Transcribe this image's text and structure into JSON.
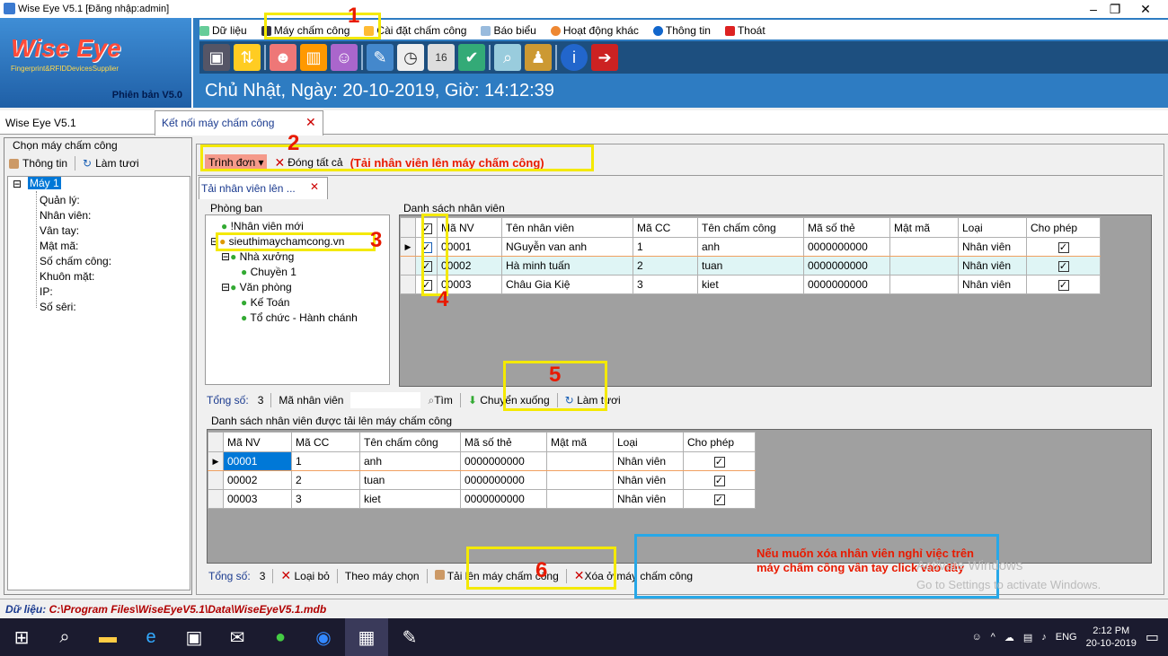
{
  "window": {
    "title": "Wise Eye V5.1 [Đăng nhập:admin]"
  },
  "logo": {
    "brand": "Wise Eye",
    "tagline": "Fingerprint&RFIDDevicesSupplier",
    "version": "Phiên bản V5.0"
  },
  "menu": [
    "Dữ liệu",
    "Máy chấm công",
    "Cài đặt chấm công",
    "Báo biểu",
    "Hoạt động khác",
    "Thông tin",
    "Thoát"
  ],
  "datetime": "Chủ Nhật, Ngày: 20-10-2019, Giờ: 14:12:39",
  "tabs": {
    "home": "Wise Eye V5.1",
    "connect": "Kết nối máy chấm công"
  },
  "left": {
    "group_title": "Chọn máy chấm công",
    "info_btn": "Thông tin",
    "refresh_btn": "Làm tươi",
    "machine": "Máy 1",
    "props": [
      "Quản lý:",
      "Nhân viên:",
      "Vân tay:",
      "Mật mã:",
      "Số chấm công:",
      "Khuôn mặt:",
      "IP:",
      "Số sêri:"
    ]
  },
  "main": {
    "menu_btn": "Trình đơn",
    "close_all": "Đóng tất cả",
    "callout_title": "(Tải nhân viên lên máy chấm công)",
    "subtab": "Tải nhân viên lên ...",
    "dept_title": "Phòng ban",
    "depts": [
      "!Nhân viên mới",
      "sieuthimaychamcong.vn",
      "Nhà xưởng",
      "Chuyền 1",
      "Văn phòng",
      "Kế Toán",
      "Tổ chức - Hành chánh"
    ],
    "emp_list_title": "Danh sách nhân viên",
    "emp_cols": [
      "Mã NV",
      "Tên nhân viên",
      "Mã CC",
      "Tên chấm công",
      "Mã số thẻ",
      "Mật mã",
      "Loại",
      "Cho phép"
    ],
    "emp_rows": [
      [
        "00001",
        "NGuyễn van anh",
        "1",
        "anh",
        "0000000000",
        "",
        "Nhân viên"
      ],
      [
        "00002",
        "Hà minh tuấn",
        "2",
        "tuan",
        "0000000000",
        "",
        "Nhân viên"
      ],
      [
        "00003",
        "Châu Gia Kiệ",
        "3",
        "kiet",
        "0000000000",
        "",
        "Nhân viên"
      ]
    ],
    "total_label": "Tổng số:",
    "total": "3",
    "empid_label": "Mã nhân viên",
    "search": "Tìm",
    "move_down": "Chuyển xuống",
    "refresh": "Làm tươi",
    "upload_list_title": "Danh sách nhân viên được tải lên máy chấm công",
    "up_cols": [
      "Mã NV",
      "Mã CC",
      "Tên chấm công",
      "Mã số thẻ",
      "Mật mã",
      "Loại",
      "Cho phép"
    ],
    "up_rows": [
      [
        "00001",
        "1",
        "anh",
        "0000000000",
        "",
        "Nhân viên"
      ],
      [
        "00002",
        "2",
        "tuan",
        "0000000000",
        "",
        "Nhân viên"
      ],
      [
        "00003",
        "3",
        "kiet",
        "0000000000",
        "",
        "Nhân viên"
      ]
    ],
    "remove": "Loại bỏ",
    "by_machine": "Theo máy chọn",
    "upload": "Tải lên máy chấm công",
    "delete_machine": "Xóa ở máy chấm công",
    "note": "Nếu  muốn xóa nhân viên nghỉ việc trên máy chấm công vân tay click vào đây",
    "watermark1": "Activate Windows",
    "watermark2": "Go to Settings to activate Windows.",
    "steps": [
      "1",
      "2",
      "3",
      "4",
      "5",
      "6"
    ]
  },
  "status": {
    "label": "Dữ liệu:",
    "path": "C:\\Program Files\\WiseEyeV5.1\\Data\\WiseEyeV5.1.mdb"
  },
  "taskbar": {
    "time": "2:12 PM",
    "date": "20-10-2019",
    "lang": "ENG"
  },
  "colors": {
    "header": "#2e7cc2",
    "annotation_yellow": "#f4e900",
    "annotation_red": "#e81a00",
    "annotation_blue": "#27a8e8"
  }
}
